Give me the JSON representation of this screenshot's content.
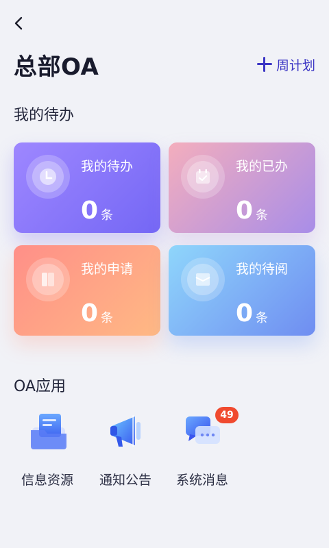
{
  "header": {
    "title": "总部OA",
    "weekly_plan_label": "周计划"
  },
  "todo": {
    "section_title": "我的待办",
    "cards": [
      {
        "label": "我的待办",
        "count": "0",
        "unit": "条"
      },
      {
        "label": "我的已办",
        "count": "0",
        "unit": "条"
      },
      {
        "label": "我的申请",
        "count": "0",
        "unit": "条"
      },
      {
        "label": "我的待阅",
        "count": "0",
        "unit": "条"
      }
    ]
  },
  "apps": {
    "section_title": "OA应用",
    "items": [
      {
        "label": "信息资源"
      },
      {
        "label": "通知公告"
      },
      {
        "label": "系统消息",
        "badge": "49"
      }
    ]
  },
  "colors": {
    "accent": "#3b35c4",
    "badge": "#f04a2f",
    "background": "#f1f2f7"
  },
  "icons": {
    "back": "chevron-left-icon",
    "weekly": "plus-icon",
    "todo": "clock-icon",
    "done": "calendar-check-icon",
    "apply": "document-icon",
    "read": "mail-icon",
    "info": "folder-icon",
    "notice": "megaphone-icon",
    "messages": "chat-bubbles-icon"
  }
}
